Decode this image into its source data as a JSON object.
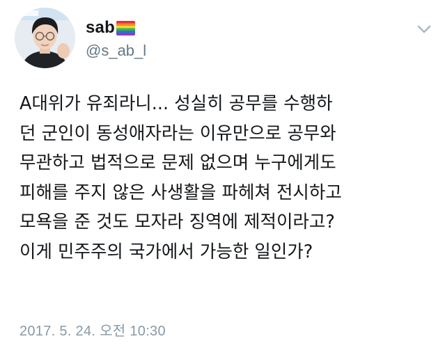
{
  "author": {
    "display_name": "sab",
    "handle": "@s_ab_l",
    "name_emoji": "rainbow-flag-icon"
  },
  "menu": {
    "icon": "chevron-down-icon"
  },
  "tweet": {
    "lines": [
      "A대위가 유죄라니... 성실히 공무를 수행하",
      "던 군인이 동성애자라는 이유만으로 공무와",
      "무관하고 법적으로 문제 없으며 누구에게도",
      "피해를 주지 않은 사생활을 파헤쳐 전시하고",
      "모욕을 준 것도 모자라 징역에 제적이라고?",
      "이게 민주주의 국가에서 가능한 일인가?"
    ],
    "timestamp": "2017. 5. 24. 오전 10:30"
  },
  "colors": {
    "text": "#14171a",
    "secondary": "#657786",
    "timestamp": "#8899a6",
    "caret": "#aab8c2"
  }
}
